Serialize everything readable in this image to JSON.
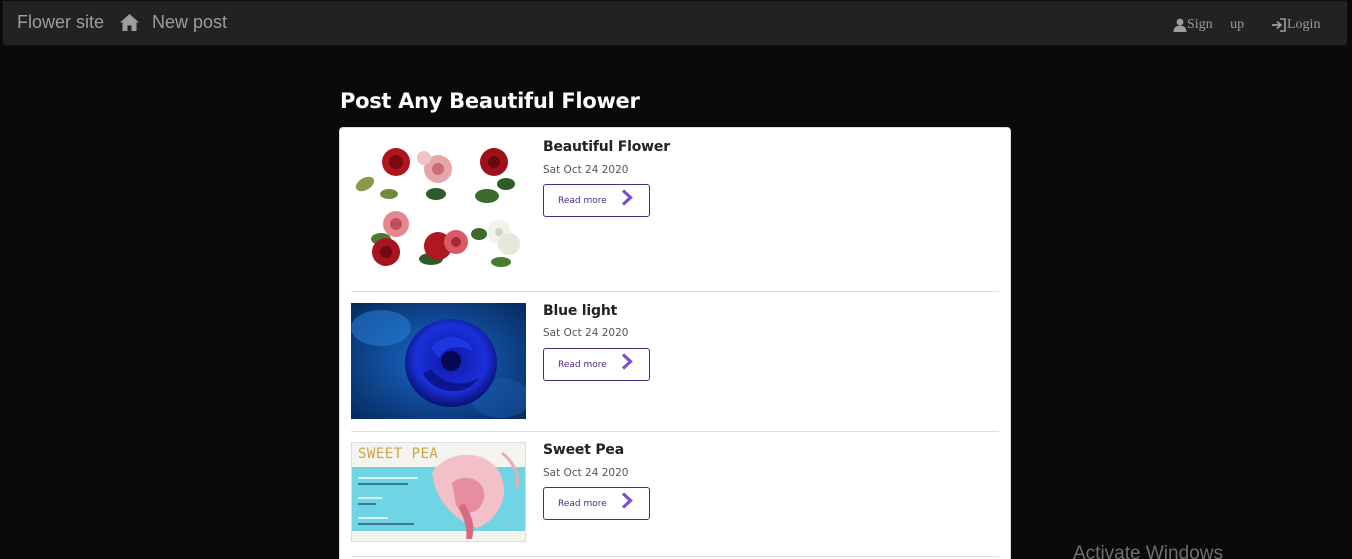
{
  "navbar": {
    "brand": "Flower site",
    "home_icon": "home-icon",
    "new_post": "New post",
    "signup": {
      "icon": "user-icon",
      "label": "Sign up"
    },
    "login": {
      "icon": "login-icon",
      "label": "Login"
    }
  },
  "page": {
    "heading": "Post Any Beautiful Flower"
  },
  "posts": [
    {
      "title": "Beautiful Flower",
      "date": "Sat Oct 24 2020",
      "read_more": "Read more"
    },
    {
      "title": "Blue light",
      "date": "Sat Oct 24 2020",
      "read_more": "Read more"
    },
    {
      "title": "Sweet Pea",
      "date": "Sat Oct 24 2020",
      "read_more": "Read more"
    }
  ],
  "thumbnails": {
    "sweet_pea_label": "SWEET PEA"
  },
  "watermark": "Activate Windows",
  "colors": {
    "background": "#0a0a0c",
    "navbar": "#222222",
    "nav_text": "#9d9d9d",
    "accent": "#4b2a8a"
  }
}
